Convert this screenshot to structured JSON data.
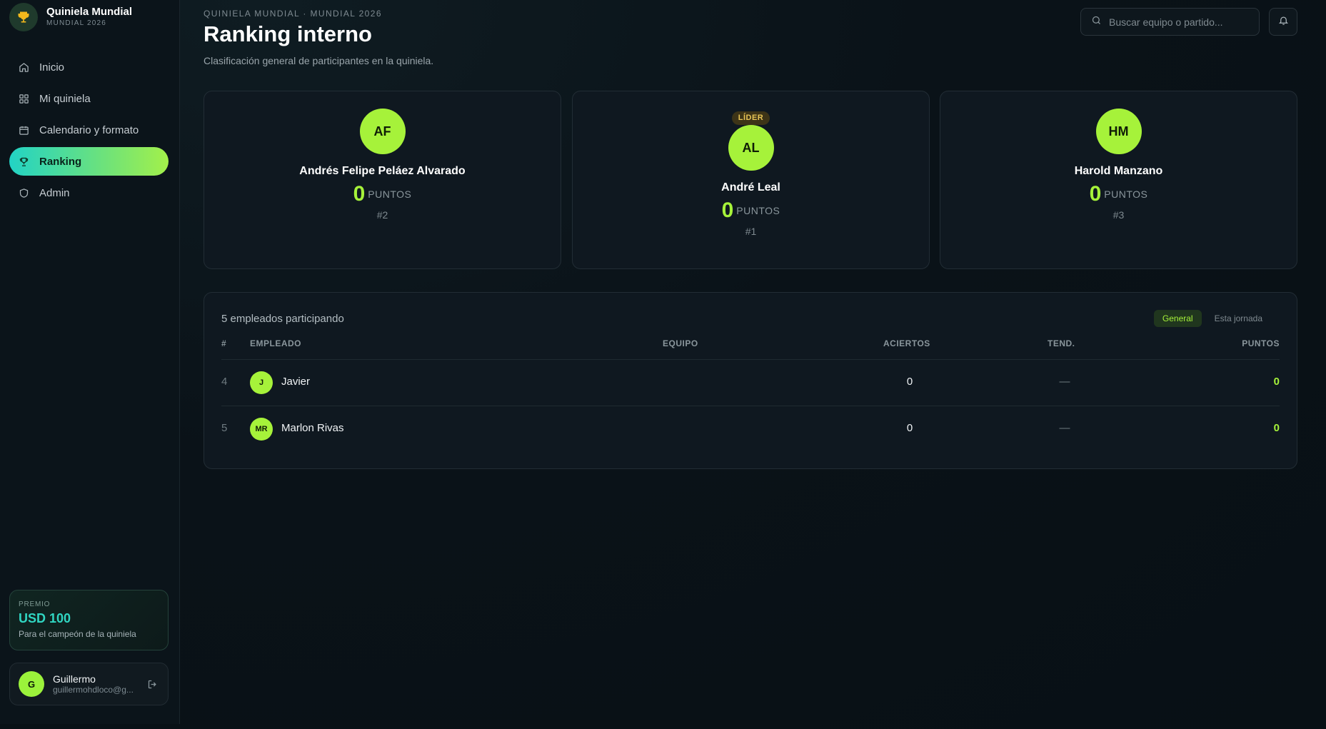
{
  "brand": {
    "title": "Quiniela Mundial",
    "subtitle": "MUNDIAL 2026",
    "logo_icon": "trophy-icon"
  },
  "nav": {
    "items": [
      {
        "label": "Inicio",
        "icon": "home-icon",
        "active": false
      },
      {
        "label": "Mi quiniela",
        "icon": "grid-icon",
        "active": false
      },
      {
        "label": "Calendario y formato",
        "icon": "calendar-icon",
        "active": false
      },
      {
        "label": "Ranking",
        "icon": "trophy-icon",
        "active": true
      },
      {
        "label": "Admin",
        "icon": "shield-icon",
        "active": false
      }
    ]
  },
  "prize": {
    "label": "PREMIO",
    "amount": "USD 100",
    "description": "Para el campeón de la quiniela"
  },
  "user": {
    "initial": "G",
    "name": "Guillermo",
    "email": "guillermohdloco@g..."
  },
  "header": {
    "eyebrow": "QUINIELA MUNDIAL · MUNDIAL 2026",
    "title": "Ranking interno",
    "subtitle": "Clasificación general de participantes en la quiniela.",
    "search_placeholder": "Buscar equipo o partido..."
  },
  "podium": {
    "second": {
      "initials": "AF",
      "name": "Andrés Felipe Peláez Alvarado",
      "points": "0",
      "points_label": "PUNTOS",
      "rank": "#2"
    },
    "first": {
      "badge": "LÍDER",
      "initials": "AL",
      "name": "André Leal",
      "points": "0",
      "points_label": "PUNTOS",
      "rank": "#1"
    },
    "third": {
      "initials": "HM",
      "name": "Harold Manzano",
      "points": "0",
      "points_label": "PUNTOS",
      "rank": "#3"
    }
  },
  "table": {
    "count_text": "5 empleados participando",
    "toggle": {
      "general": "General",
      "jornada": "Esta jornada"
    },
    "headers": {
      "rank": "#",
      "empleado": "EMPLEADO",
      "equipo": "EQUIPO",
      "aciertos": "ACIERTOS",
      "tend": "TEND.",
      "puntos": "PUNTOS"
    },
    "rows": [
      {
        "rank": "4",
        "initials": "J",
        "name": "Javier",
        "aciertos": "0",
        "tend": "—",
        "puntos": "0"
      },
      {
        "rank": "5",
        "initials": "MR",
        "name": "Marlon Rivas",
        "aciertos": "0",
        "tend": "—",
        "puntos": "0"
      }
    ]
  },
  "colors": {
    "accent": "#a6f23a",
    "teal": "#22d3c5",
    "background": "#0a1218",
    "gold": "#e8c556"
  }
}
